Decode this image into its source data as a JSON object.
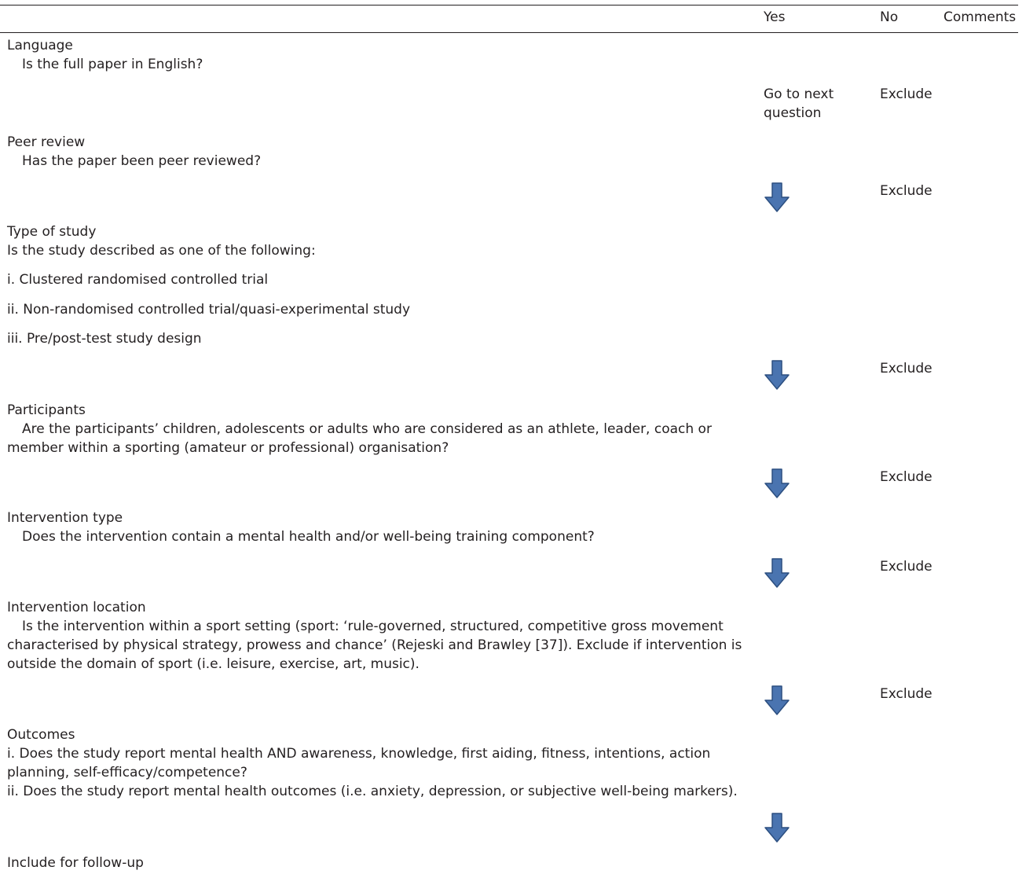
{
  "header": {
    "yes": "Yes",
    "no": "No",
    "comments": "Comments"
  },
  "sections": {
    "language": {
      "title": "Language",
      "question": "Is the full paper in English?",
      "yes_text_1": "Go to next",
      "yes_text_2": "question",
      "no_text": "Exclude"
    },
    "peer_review": {
      "title": "Peer review",
      "question": "Has the paper been peer reviewed?",
      "no_text": "Exclude"
    },
    "type_of_study": {
      "title": "Type of study",
      "question": "Is the study described as one of the following:",
      "options": [
        "i. Clustered randomised controlled trial",
        "ii. Non-randomised controlled trial/quasi-experimental study",
        "iii. Pre/post-test study design"
      ],
      "no_text": "Exclude"
    },
    "participants": {
      "title": "Participants",
      "question_line1": "Are the participants’ children, adolescents or adults who are considered as an athlete, leader, coach or",
      "question_line2": "member within a sporting (amateur or professional) organisation?",
      "no_text": "Exclude"
    },
    "intervention_type": {
      "title": "Intervention type",
      "question": "Does the intervention contain a mental health and/or well-being training component?",
      "no_text": "Exclude"
    },
    "intervention_location": {
      "title": "Intervention location",
      "question_line1": "Is the intervention within a sport setting (sport: ‘rule-governed, structured, competitive gross movement",
      "question_line2": "characterised by physical strategy, prowess and chance’ (Rejeski and Brawley [37]). Exclude if intervention is",
      "question_line3": "outside the domain of sport (i.e. leisure, exercise, art, music).",
      "no_text": "Exclude"
    },
    "outcomes": {
      "title": "Outcomes",
      "line1": "i. Does the study report mental health AND awareness, knowledge, first aiding, fitness, intentions, action",
      "line2": "planning, self-efficacy/competence?",
      "line3": "ii. Does the study report mental health outcomes (i.e. anxiety, depression, or subjective well-being markers)."
    },
    "final": {
      "title": "Include for follow-up"
    }
  },
  "colors": {
    "arrow_fill": "#4a74b0",
    "arrow_stroke": "#2c4f80",
    "text": "#231f20"
  },
  "icons": {
    "proceed": "arrow-down-icon"
  }
}
